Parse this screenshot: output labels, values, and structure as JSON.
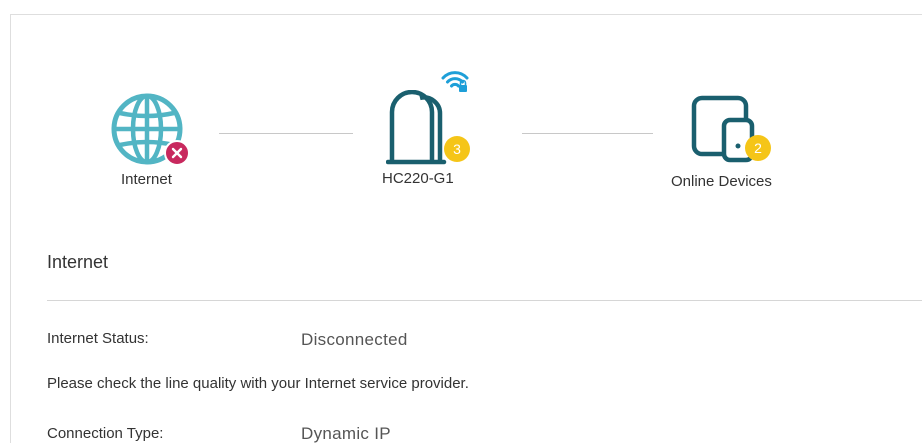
{
  "topology": {
    "internet_label": "Internet",
    "device_label": "HC220-G1",
    "device_badge": "3",
    "online_label": "Online Devices",
    "online_badge": "2"
  },
  "icons": {
    "internet": "globe-icon",
    "internet_status": "disconnected-x-icon",
    "router": "router-icon",
    "wifi": "wifi-lock-icon",
    "devices": "devices-icon"
  },
  "colors": {
    "accent": "#1a5f6e",
    "globe": "#52b5c4",
    "wifi": "#1e9fd8",
    "badge": "#f5c518",
    "error": "#c8295e"
  },
  "section": {
    "title": "Internet"
  },
  "details": {
    "status_label": "Internet Status:",
    "status_value": "Disconnected",
    "note": "Please check the line quality with your Internet service provider.",
    "connection_type_label": "Connection Type:",
    "connection_type_value": "Dynamic IP"
  }
}
